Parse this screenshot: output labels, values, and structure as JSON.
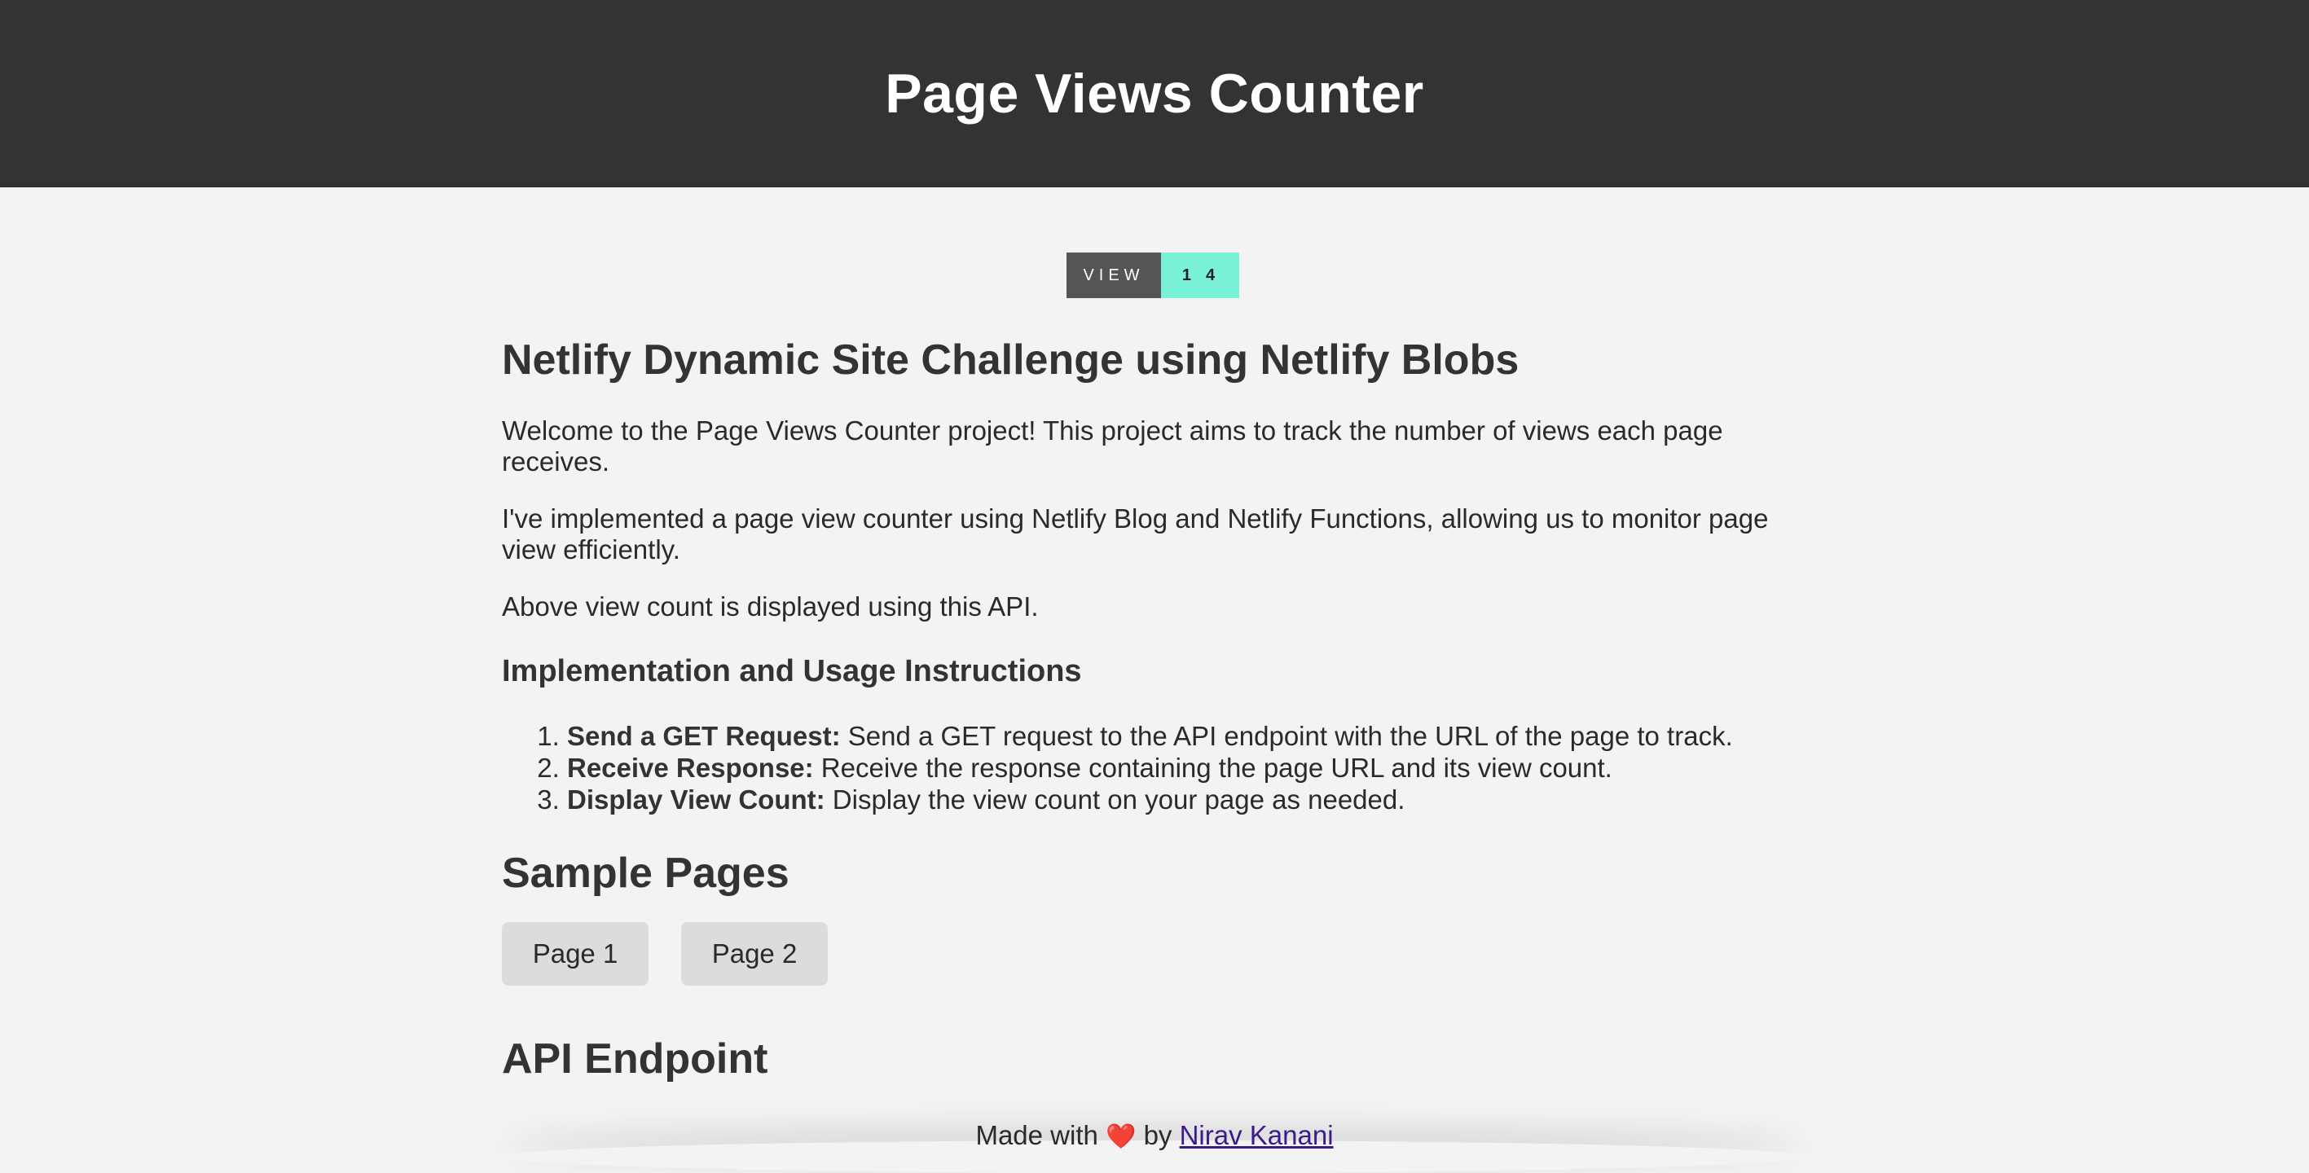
{
  "header": {
    "title": "Page Views Counter"
  },
  "badge": {
    "label": "VIEW",
    "count": "14"
  },
  "main": {
    "title": "Netlify Dynamic Site Challenge using Netlify Blobs",
    "intro_1": "Welcome to the Page Views Counter project! This project aims to track the number of views each page receives.",
    "intro_2": "I've implemented a page view counter using Netlify Blog and Netlify Functions, allowing us to monitor page view efficiently.",
    "intro_3": "Above view count is displayed using this API.",
    "instructions_heading": "Implementation and Usage Instructions",
    "steps": [
      {
        "title": "Send a GET Request:",
        "text": " Send a GET request to the API endpoint with the URL of the page to track."
      },
      {
        "title": "Receive Response:",
        "text": " Receive the response containing the page URL and its view count."
      },
      {
        "title": "Display View Count:",
        "text": " Display the view count on your page as needed."
      }
    ],
    "sample_heading": "Sample Pages",
    "sample_pages": [
      {
        "label": "Page 1"
      },
      {
        "label": "Page 2"
      }
    ],
    "api_heading": "API Endpoint"
  },
  "footer": {
    "made_with": "Made with",
    "heart_icon": "heart-icon",
    "by": "by",
    "author": "Nirav Kanani"
  },
  "colors": {
    "header_bg": "#333333",
    "badge_label_bg": "#555555",
    "badge_count_bg": "#7af2d8",
    "page_bg": "#f3f3f3"
  }
}
